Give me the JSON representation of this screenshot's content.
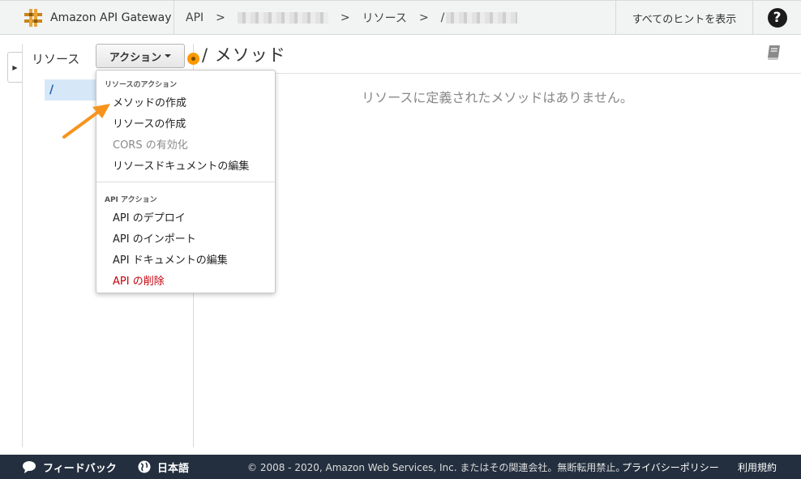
{
  "app": {
    "name": "Amazon API Gateway"
  },
  "breadcrumb": {
    "api": "API",
    "sep": ">",
    "resources": "リソース",
    "path_prefix": "/"
  },
  "header": {
    "hints": "すべてのヒントを表示",
    "help": "?"
  },
  "resources_panel": {
    "label": "リソース",
    "actions_button": "アクション",
    "tree_root": "/"
  },
  "main": {
    "title": "/ メソッド",
    "empty_message": "リソースに定義されたメソッドはありません。"
  },
  "dropdown": {
    "resource_section": "リソースのアクション",
    "resource_items": [
      {
        "label": "メソッドの作成",
        "state": "normal"
      },
      {
        "label": "リソースの作成",
        "state": "normal"
      },
      {
        "label": "CORS の有効化",
        "state": "disabled"
      },
      {
        "label": "リソースドキュメントの編集",
        "state": "normal"
      }
    ],
    "api_section": "API アクション",
    "api_items": [
      {
        "label": "API のデプロイ",
        "state": "normal"
      },
      {
        "label": "API のインポート",
        "state": "normal"
      },
      {
        "label": "API ドキュメントの編集",
        "state": "normal"
      },
      {
        "label": "API の削除",
        "state": "danger"
      }
    ]
  },
  "footer": {
    "feedback": "フィードバック",
    "language": "日本語",
    "copyright": "© 2008 - 2020, Amazon Web Services, Inc. またはその関連会社。無断転用禁止。",
    "privacy": "プライバシーポリシー",
    "terms": "利用規約"
  },
  "colors": {
    "accent_orange": "#ff9900",
    "danger": "#c5000c",
    "footer_bg": "#232f3e"
  }
}
